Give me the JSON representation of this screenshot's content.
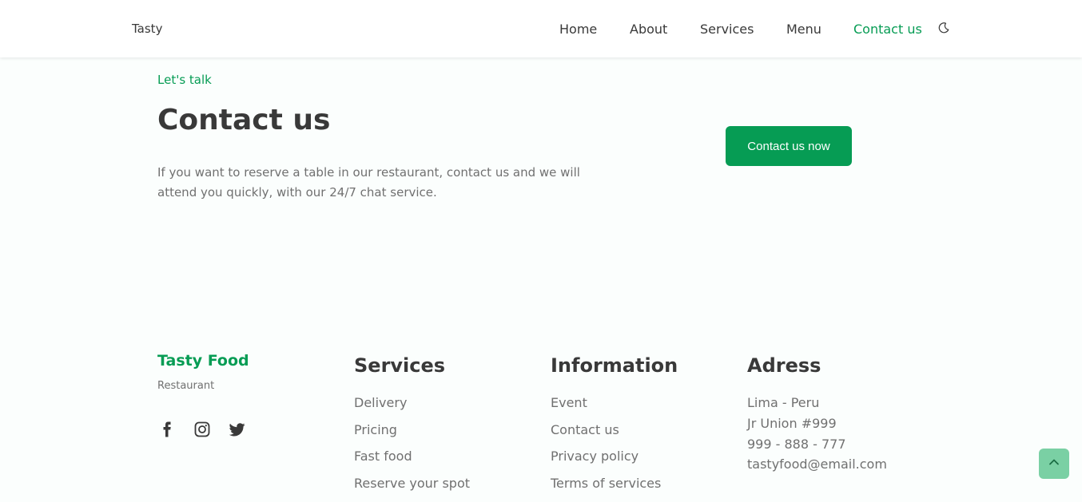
{
  "header": {
    "logo": "Tasty",
    "nav": [
      "Home",
      "About",
      "Services",
      "Menu",
      "Contact us"
    ],
    "active_nav": "Contact us",
    "theme_icon": "moon-icon"
  },
  "contact": {
    "subtitle": "Let's talk",
    "title": "Contact us",
    "description": "If you want to reserve a table in our restaurant, contact us and we will attend you quickly, with our 24/7 chat service.",
    "button": "Contact us now"
  },
  "footer": {
    "brand": "Tasty Food",
    "brand_sub": "Restaurant",
    "social_icons": [
      "facebook-icon",
      "instagram-icon",
      "twitter-icon"
    ],
    "services": {
      "title": "Services",
      "items": [
        "Delivery",
        "Pricing",
        "Fast food",
        "Reserve your spot"
      ]
    },
    "information": {
      "title": "Information",
      "items": [
        "Event",
        "Contact us",
        "Privacy policy",
        "Terms of services"
      ]
    },
    "address": {
      "title": "Adress",
      "items": [
        "Lima - Peru",
        "Jr Union #999",
        "999 - 888 - 777",
        "tastyfood@email.com"
      ]
    }
  },
  "scrollup_icon": "chevron-up-icon",
  "colors": {
    "accent": "#069c54",
    "text": "#393939",
    "muted": "#707070",
    "scrollup": "#7ad0a4"
  }
}
